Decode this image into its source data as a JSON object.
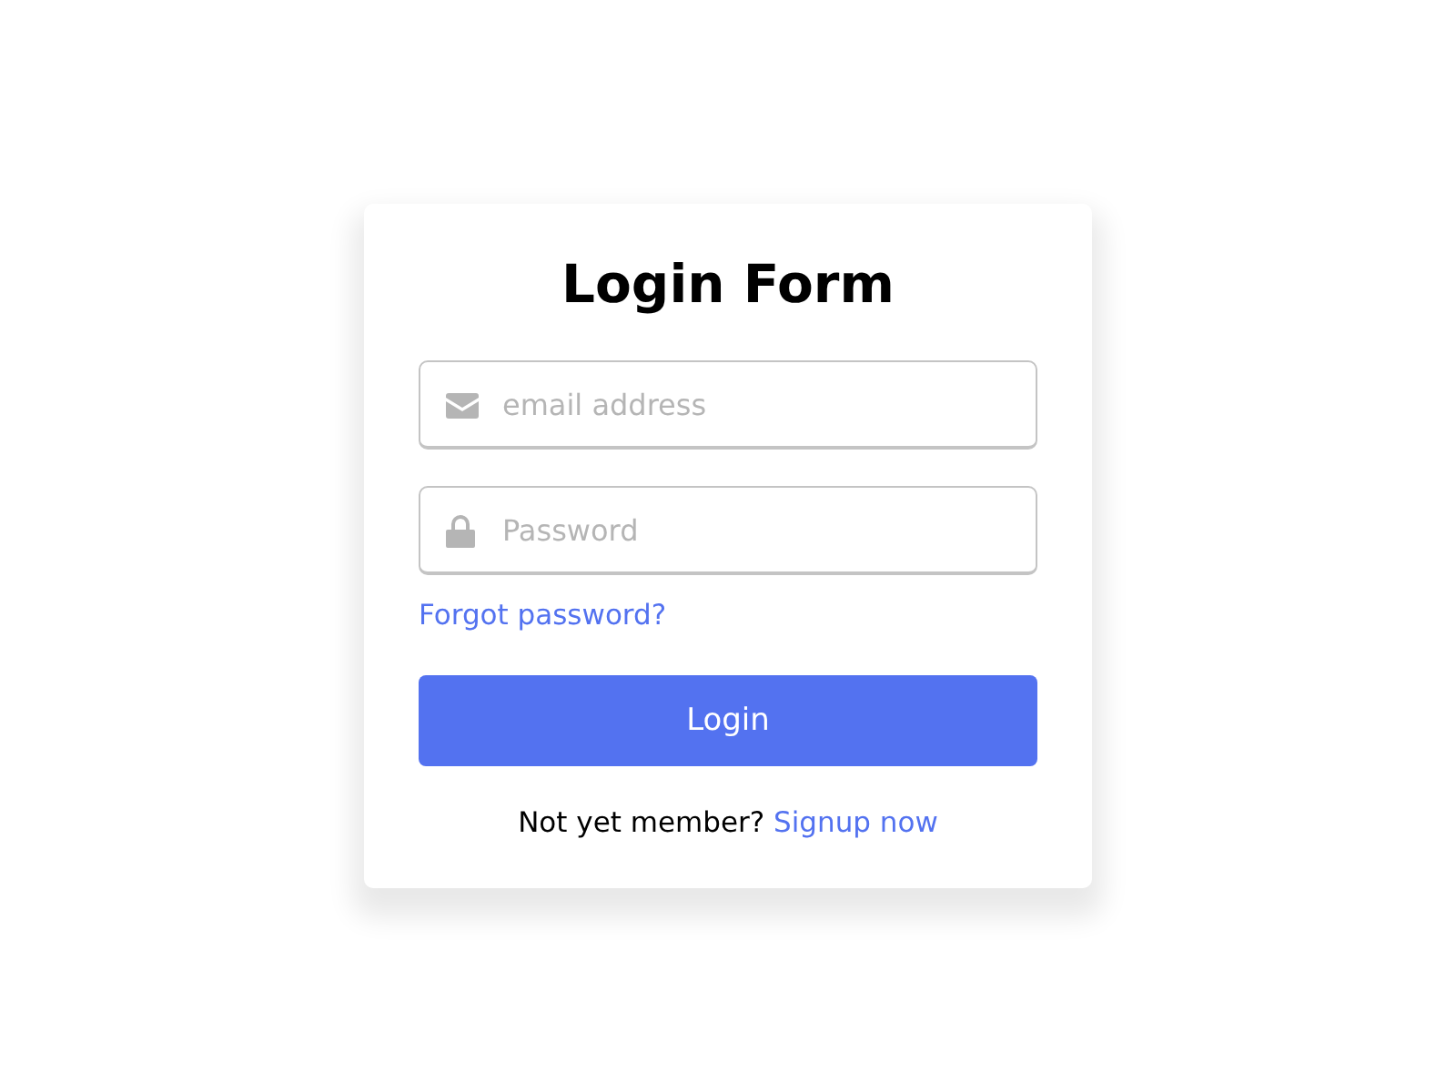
{
  "title": "Login Form",
  "fields": [
    {
      "kind": "email",
      "placeholder": "email address"
    },
    {
      "kind": "password",
      "placeholder": "Password"
    }
  ],
  "forgot_link": "Forgot password?",
  "submit_button": "Login",
  "signup": {
    "prompt": "Not yet member?",
    "link": "Signup now"
  }
}
